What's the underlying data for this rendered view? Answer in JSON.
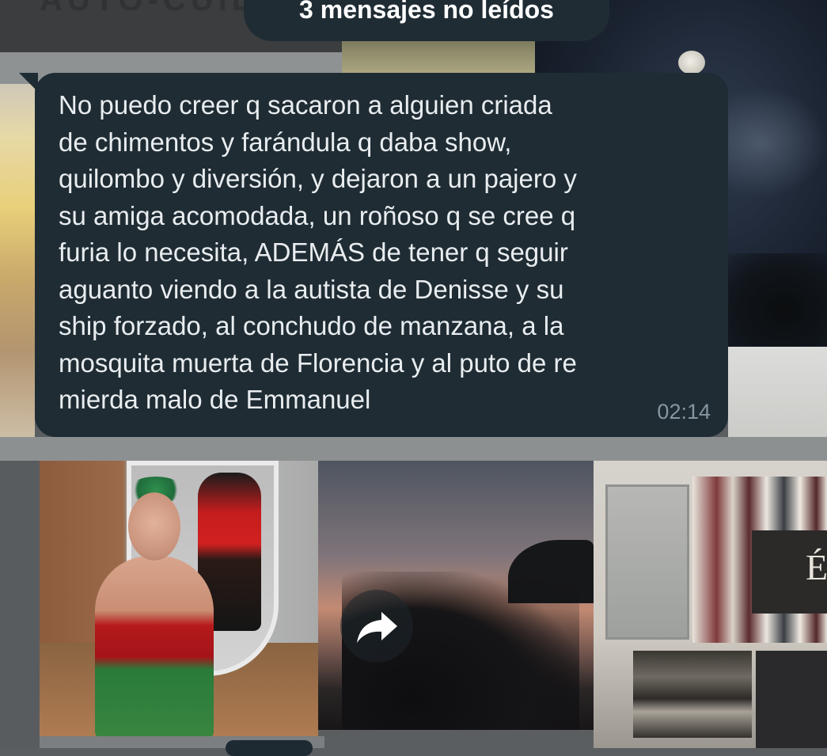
{
  "wallpaper": {
    "top_cut_text": "AUTO-CUIDA",
    "closet_sign_letter": "É"
  },
  "unread_banner": {
    "label": "3 mensajes no leídos"
  },
  "message": {
    "text": "No puedo creer q sacaron a alguien criada\nde chimentos y farándula q daba show,\nquilombo y diversión, y dejaron a un pajero y\nsu amiga acomodada, un roñoso q se cree q\nfuria lo necesita, ADEMÁS de tener q seguir\naguanto viendo a la autista de Denisse y su\nship forzado, al  conchudo de manzana, a la\nmosquita muerta de Florencia y al puto de re\nmierda malo de Emmanuel",
    "time": "02:14"
  },
  "forward": {
    "icon": "forward-icon"
  },
  "colors": {
    "bubble": "#1f2c34",
    "message_text": "#e9edef",
    "timestamp": "#8696a0"
  }
}
